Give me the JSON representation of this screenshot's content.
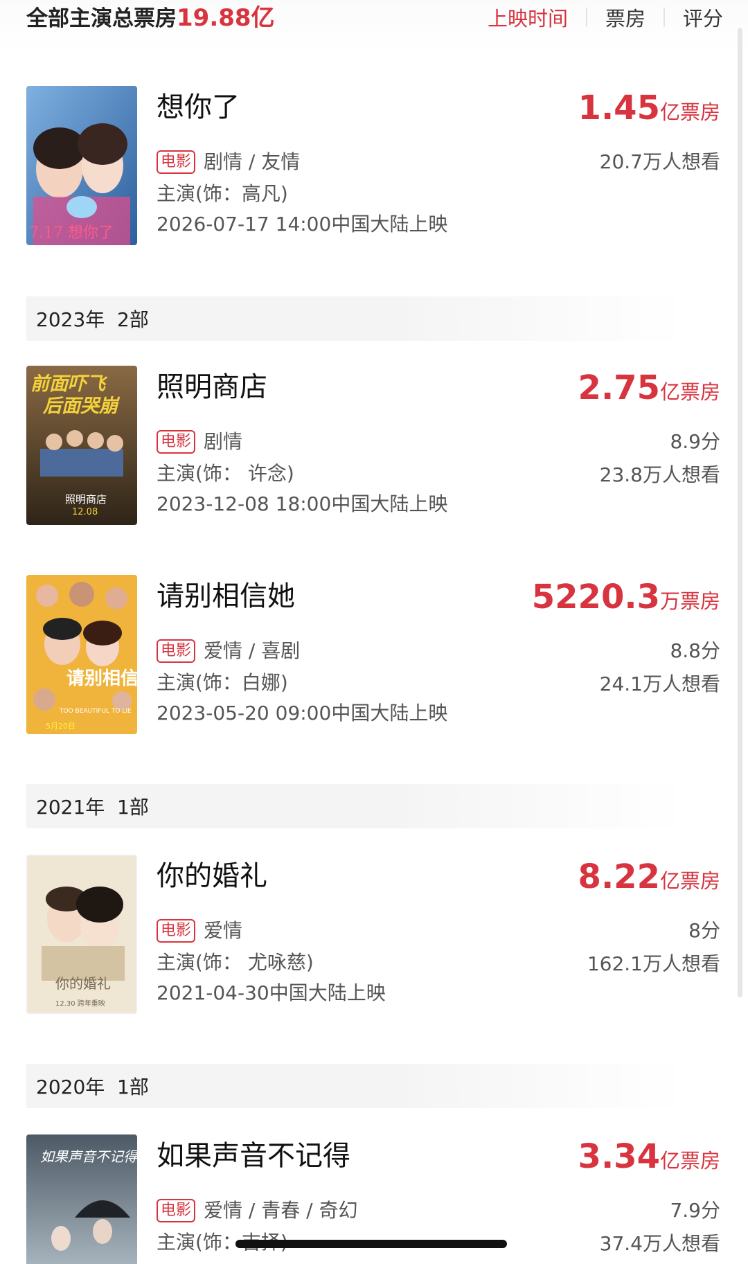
{
  "header": {
    "total_label": "全部主演总票房",
    "total_amount": "19.88亿",
    "sort": [
      "上映时间",
      "票房",
      "评分"
    ]
  },
  "sections": [
    {
      "label": "2023年  2部"
    },
    {
      "label": "2021年  1部"
    },
    {
      "label": "2020年  1部"
    }
  ],
  "movies": [
    {
      "title": "想你了",
      "boxoffice": "1.45",
      "unit": "亿票房",
      "tag": "电影",
      "genres": "剧情 / 友情",
      "role": "主演(饰：高凡)",
      "release": "2026-07-17 14:00中国大陆上映",
      "score": "",
      "want": "20.7万人想看",
      "poster_color": "#5b8fc9"
    },
    {
      "title": "照明商店",
      "boxoffice": "2.75",
      "unit": "亿票房",
      "tag": "电影",
      "genres": "剧情",
      "role": "主演(饰：  许念)",
      "release": "2023-12-08 18:00中国大陆上映",
      "score": "8.9分",
      "want": "23.8万人想看",
      "poster_color": "#6a4a2e"
    },
    {
      "title": "请别相信她",
      "boxoffice": "5220.3",
      "unit": "万票房",
      "tag": "电影",
      "genres": "爱情 / 喜剧",
      "role": "主演(饰：白娜)",
      "release": "2023-05-20 09:00中国大陆上映",
      "score": "8.8分",
      "want": "24.1万人想看",
      "poster_color": "#e0a43a"
    },
    {
      "title": "你的婚礼",
      "boxoffice": "8.22",
      "unit": "亿票房",
      "tag": "电影",
      "genres": "爱情",
      "role": "主演(饰：  尤咏慈)",
      "release": "2021-04-30中国大陆上映",
      "score": "8分",
      "want": "162.1万人想看",
      "poster_color": "#d9c8a8"
    },
    {
      "title": "如果声音不记得",
      "boxoffice": "3.34",
      "unit": "亿票房",
      "tag": "电影",
      "genres": "爱情 / 青春 / 奇幻",
      "role": "主演(饰：吉择)",
      "release": "",
      "score": "7.9分",
      "want": "37.4万人想看",
      "poster_color": "#6f7c86"
    }
  ],
  "poster_text": {
    "p1": "7.17 想你了",
    "p2_top": "前面吓飞",
    "p2_bottom": "后面哭崩",
    "p2_brand": "照明商店",
    "p2_date": "12.08",
    "p3_main": "请别相信她",
    "p3_sub": "TOO BEAUTIFUL TO LIE",
    "p3_date": "5月20日",
    "p4_main": "你的婚礼",
    "p4_date": "12.30 跨年重映",
    "p5_main": "如果声音不记得"
  },
  "colors": {
    "accent": "#d8343f"
  }
}
